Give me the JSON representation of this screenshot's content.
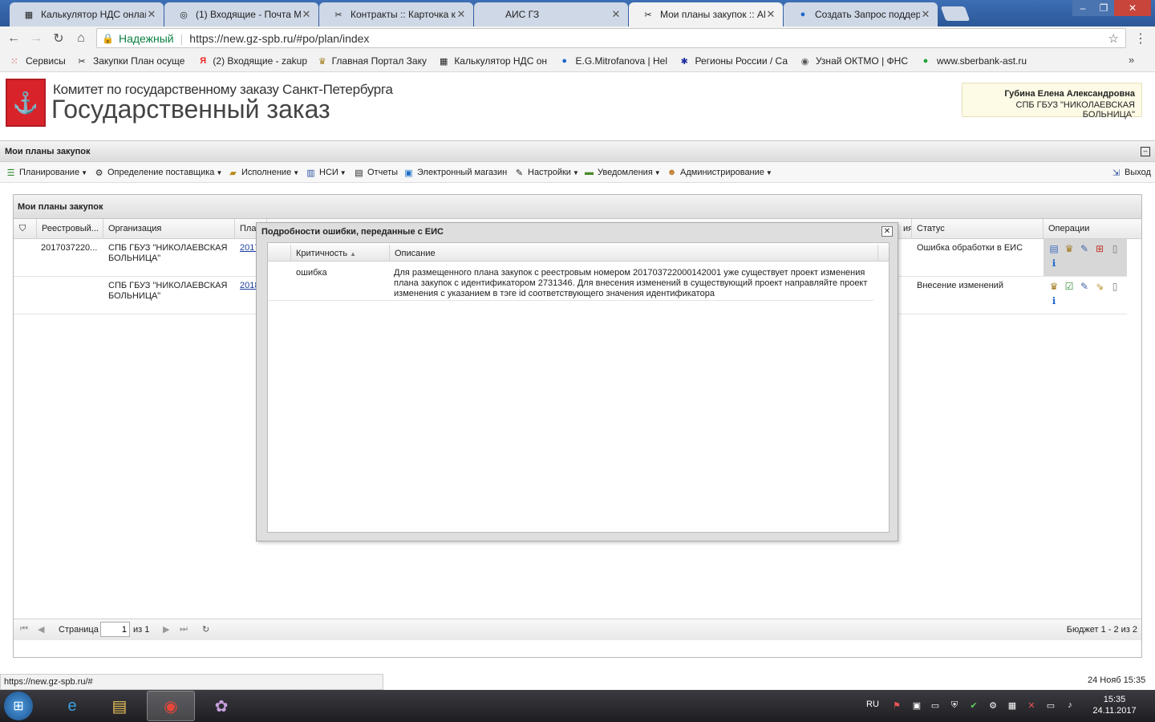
{
  "browser": {
    "tabs": [
      {
        "title": "Калькулятор НДС онлай",
        "icon": "calculator-icon",
        "active": false
      },
      {
        "title": "(1) Входящие - Почта М",
        "icon": "mail-icon",
        "active": false
      },
      {
        "title": "Контракты :: Карточка к",
        "icon": "tools-icon",
        "active": false
      },
      {
        "title": "АИС ГЗ",
        "icon": "blank-icon",
        "active": false
      },
      {
        "title": "Мои планы закупок :: АИ",
        "icon": "tools-icon",
        "active": true
      },
      {
        "title": "Создать Запрос поддер",
        "icon": "help-icon",
        "active": false
      }
    ],
    "secure_label": "Надежный",
    "url": "https://new.gz-spb.ru/#po/plan/index",
    "bookmarks": [
      {
        "label": "Сервисы",
        "icon": "apps-icon"
      },
      {
        "label": "Закупки План осуще",
        "icon": "tools-icon"
      },
      {
        "label": "(2) Входящие - zakup",
        "icon": "yandex-icon"
      },
      {
        "label": "Главная Портал Заку",
        "icon": "eagle-icon"
      },
      {
        "label": "Калькулятор НДС он",
        "icon": "calculator-icon"
      },
      {
        "label": "E.G.Mitrofanova | Hel",
        "icon": "help-icon"
      },
      {
        "label": "Регионы России / Са",
        "icon": "star-icon"
      },
      {
        "label": "Узнай ОКТМО | ФНС",
        "icon": "emblem-icon"
      },
      {
        "label": "www.sberbank-ast.ru",
        "icon": "sber-icon"
      }
    ],
    "status_url": "https://new.gz-spb.ru/#"
  },
  "header": {
    "org_title": "Комитет по государственному заказу Санкт-Петербурга",
    "app_title": "Государственный заказ",
    "user_name": "Губина Елена Александровна",
    "user_org": "СПБ ГБУЗ \"НИКОЛАЕВСКАЯ БОЛЬНИЦА\""
  },
  "section": {
    "title": "Мои планы закупок"
  },
  "menu": {
    "items": [
      {
        "label": "Планирование",
        "icon": "planning-icon",
        "dropdown": true
      },
      {
        "label": "Определение поставщика",
        "icon": "gears-icon",
        "dropdown": true
      },
      {
        "label": "Исполнение",
        "icon": "folder-icon",
        "dropdown": true
      },
      {
        "label": "НСИ",
        "icon": "book-icon",
        "dropdown": true
      },
      {
        "label": "Отчеты",
        "icon": "report-icon",
        "dropdown": false
      },
      {
        "label": "Электронный магазин",
        "icon": "cart-icon",
        "dropdown": false
      },
      {
        "label": "Настройки",
        "icon": "wrench-icon",
        "dropdown": true
      },
      {
        "label": "Уведомления",
        "icon": "notification-icon",
        "dropdown": true
      },
      {
        "label": "Администрирование",
        "icon": "user-icon",
        "dropdown": true
      }
    ],
    "logout": "Выход"
  },
  "grid": {
    "title": "Мои планы закупок",
    "columns": [
      "Реестровый...",
      "Организация",
      "Пла",
      "Статус",
      "Операции"
    ],
    "rows": [
      {
        "reg": "2017037220...",
        "org": "СПБ ГБУЗ \"НИКОЛАЕВСКАЯ БОЛЬНИЦА\"",
        "plan": "2017",
        "status": "Ошибка обработки в ЕИС"
      },
      {
        "reg": "",
        "org": "СПБ ГБУЗ \"НИКОЛАЕВСКАЯ БОЛЬНИЦА\"",
        "plan": "2018",
        "status": "Внесение изменений"
      }
    ],
    "partial_col": "ия",
    "pager": {
      "page_label": "Страница",
      "page": "1",
      "of": "из 1",
      "summary": "Бюджет 1 - 2 из 2"
    }
  },
  "modal": {
    "title": "Подробности ошибки, переданные с ЕИС",
    "columns": [
      "Критичность",
      "Описание"
    ],
    "rows": [
      {
        "severity": "ошибка",
        "description": "Для размещенного плана закупок с реестровым номером 201703722000142001 уже существует проект изменения плана закупок с идентификатором 2731346. Для внесения изменений в существующий проект направляйте проект изменения с указанием в тэге id соответствующего значения идентификатора"
      }
    ]
  },
  "footer": {
    "datetime": "24 Нояб 15:35"
  },
  "taskbar": {
    "lang": "RU",
    "time": "15:35",
    "date": "24.11.2017"
  }
}
